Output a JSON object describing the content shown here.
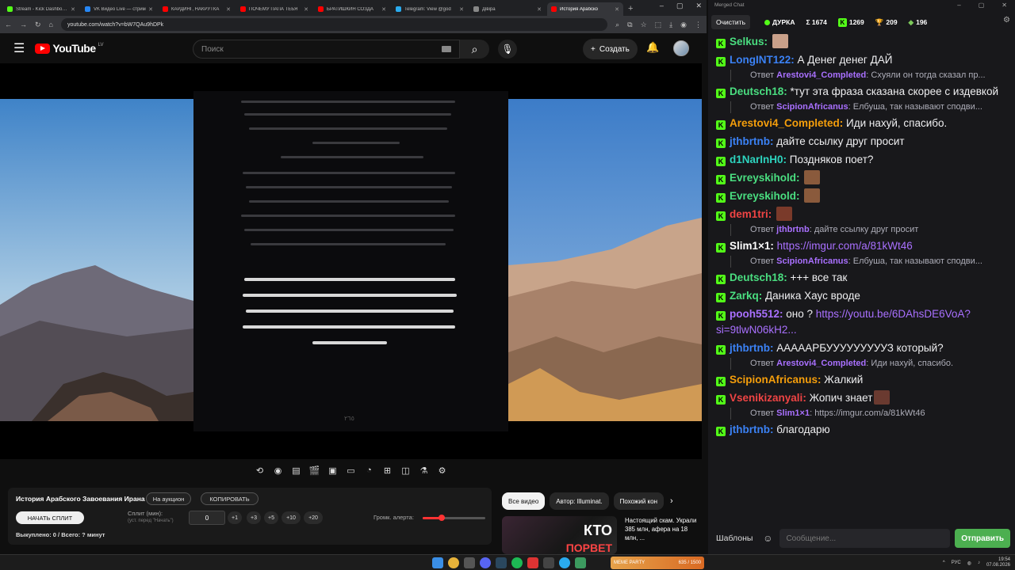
{
  "browser": {
    "tabs": [
      {
        "title": "Stream - Kick Dashboard",
        "color": "#53fc18"
      },
      {
        "title": "VK Видео Live — стрим",
        "color": "#2787f5"
      },
      {
        "title": "КАРДИНГ, НАКРУТКА",
        "color": "#ff0000"
      },
      {
        "title": "ПОЧЕМУ ПАПА ТЕБЯ",
        "color": "#ff0000"
      },
      {
        "title": "БРАТИШКИН СОЗДА",
        "color": "#ff0000"
      },
      {
        "title": "Telegram: View @god",
        "color": "#2aabee"
      },
      {
        "title": "Дівіра",
        "color": "#888888"
      },
      {
        "title": "История Арабско",
        "color": "#ff0000"
      }
    ],
    "url": "youtube.com/watch?v=bW7QAu9hDPk"
  },
  "youtube": {
    "logo": "YouTube",
    "country": "LV",
    "search_placeholder": "Поиск",
    "create_label": "Создать"
  },
  "panel": {
    "title": "История Арабского Завоевания Ирана",
    "auction_label": "На аукцион",
    "copy_label": "КОПИРОВАТЬ",
    "start_split_label": "НАЧАТЬ СПЛИТ",
    "split_label": "Сплит (мин):",
    "split_hint": "(уст. перед \"Начать\")",
    "split_value": "0",
    "increments": [
      "+1",
      "+3",
      "+5",
      "+10",
      "+20"
    ],
    "volume_label": "Громк. алерта:",
    "volume_level": 0.3,
    "bought_text": "Выкуплено: 0 / Всего: ? минут"
  },
  "chips": [
    "Все видео",
    "Автор: Illuminat.",
    "Похожий кон"
  ],
  "recommendation": {
    "title": "Настоящий скам. Украли 385 млн, афера на 18 млн, ...",
    "thumb_text": "КТО",
    "thumb_text2": "ПОРВЕТ"
  },
  "chat": {
    "window_title": "Merged Chat",
    "clear_label": "Очистить",
    "channel": "ДУРКА",
    "total": "Σ 1674",
    "kick_count": "1269",
    "trophy_count": "209",
    "bits_count": "196",
    "templates_label": "Шаблоны",
    "input_placeholder": "Сообщение...",
    "send_label": "Отправить",
    "user_colors": {
      "green": "#4ade80",
      "blue": "#3b82f6",
      "orange": "#f59e0b",
      "red": "#ef4444",
      "teal": "#2dd4bf",
      "purple": "#a970ff"
    },
    "messages": [
      {
        "user": "Selkus",
        "color": "#4ade80",
        "text": "",
        "emote": "#c9a08a"
      },
      {
        "user": "LongINT122",
        "color": "#3b82f6",
        "text": "А Денег денег ДАЙ",
        "reply_user": "Arestovi4_Completed",
        "reply_text": "Схуяли он тогда сказал пр..."
      },
      {
        "user": "Deutsch18",
        "color": "#4ade80",
        "text": "*тут эта фраза сказана скорее с издевкой",
        "reply_user": "ScipionAfricanus",
        "reply_text": "Елбуша, так называют сподви..."
      },
      {
        "user": "Arestovi4_Completed",
        "color": "#f59e0b",
        "text": "Иди нахуй, спасибо."
      },
      {
        "user": "jthbrtnb",
        "color": "#3b82f6",
        "text": "дайте ссылку друг просит"
      },
      {
        "user": "d1NarInH0",
        "color": "#2dd4bf",
        "text": "Поздняков поет?"
      },
      {
        "user": "Evreyskihold",
        "color": "#4ade80",
        "text": "",
        "emote": "#8a5a3c"
      },
      {
        "user": "Evreyskihold",
        "color": "#4ade80",
        "text": "",
        "emote": "#8a5a3c"
      },
      {
        "user": "dem1tri",
        "color": "#ef4444",
        "text": "",
        "emote": "#7a3a2a",
        "reply_user": "jthbrtnb",
        "reply_text": "дайте ссылку друг просит"
      },
      {
        "user": "Slim1×1",
        "color": "#ffffff",
        "text": "",
        "link": "https://imgur.com/a/81kWt46",
        "reply_user": "ScipionAfricanus",
        "reply_text": "Елбуша, так называют сподви..."
      },
      {
        "user": "Deutsch18",
        "color": "#4ade80",
        "text": "+++ все так"
      },
      {
        "user": "Zarkq",
        "color": "#4ade80",
        "text": "Даника Хаус вроде"
      },
      {
        "user": "pooh5512",
        "color": "#a970ff",
        "text": "оно ? ",
        "link": "https://youtu.be/6DAhsDE6VoA?si=9tlwN06kH2..."
      },
      {
        "user": "jthbrtnb",
        "color": "#3b82f6",
        "text": "АААААРБУУУУУУУУУЗ который?",
        "reply_user": "Arestovi4_Completed",
        "reply_text": "Иди нахуй, спасибо."
      },
      {
        "user": "ScipionAfricanus",
        "color": "#f59e0b",
        "text": "Жалкий"
      },
      {
        "user": "Vsenikizanyali",
        "color": "#ef4444",
        "text": "Жопич знает",
        "emote": "#6a3a30",
        "reply_user": "Slim1×1",
        "reply_text": "https://imgur.com/a/81kWt46"
      },
      {
        "user": "jthbrtnb",
        "color": "#3b82f6",
        "text": "благодарю"
      }
    ]
  },
  "taskbar": {
    "game_label": "MEME PARTY",
    "game_progress": "635 / 1500",
    "lang": "РУС",
    "time": "19:54",
    "date": "07.08.2026"
  }
}
